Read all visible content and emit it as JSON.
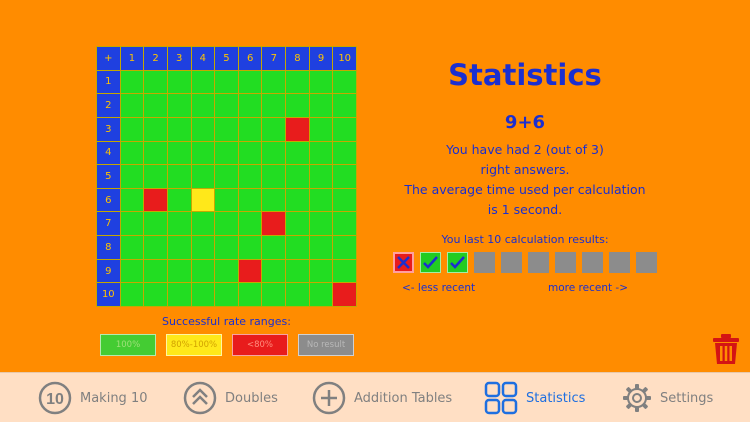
{
  "grid": {
    "corner": "+",
    "columns": [
      "1",
      "2",
      "3",
      "4",
      "5",
      "6",
      "7",
      "8",
      "9",
      "10"
    ],
    "rows": [
      "1",
      "2",
      "3",
      "4",
      "5",
      "6",
      "7",
      "8",
      "9",
      "10"
    ],
    "red_cells": [
      [
        3,
        8
      ],
      [
        6,
        2
      ],
      [
        7,
        7
      ],
      [
        9,
        6
      ],
      [
        10,
        10
      ]
    ],
    "yellow_cells": [
      [
        6,
        4
      ]
    ]
  },
  "legend": {
    "title": "Successful rate ranges:",
    "items": [
      {
        "label": "100%",
        "color": "green"
      },
      {
        "label": "80%-100%",
        "color": "yellow"
      },
      {
        "label": "<80%",
        "color": "red"
      },
      {
        "label": "No result",
        "color": "gray"
      }
    ]
  },
  "stats": {
    "title": "Statistics",
    "calculation": "9+6",
    "line1": "You have had 2 (out of 3)",
    "line2": "right answers.",
    "line3": "The average time used per calculation",
    "line4": "is 1 second.",
    "last_title": "You last 10 calculation results:",
    "results": [
      "wrong",
      "right",
      "right",
      "empty",
      "empty",
      "empty",
      "empty",
      "empty",
      "empty",
      "empty"
    ],
    "less_recent": "<- less recent",
    "more_recent": "more recent ->"
  },
  "tabs": [
    {
      "label": "Making 10",
      "icon": "ten-circle-icon",
      "active": false
    },
    {
      "label": "Doubles",
      "icon": "double-chevron-up-icon",
      "active": false
    },
    {
      "label": "Addition Tables",
      "icon": "plus-circle-icon",
      "active": false
    },
    {
      "label": "Statistics",
      "icon": "grid-squares-icon",
      "active": true
    },
    {
      "label": "Settings",
      "icon": "gear-icon",
      "active": false
    }
  ],
  "icons": {
    "trash": "trash-icon"
  },
  "colors": {
    "background": "#FF8C00",
    "accent_blue": "#1B2FD0",
    "tab_active": "#1E6FE0",
    "cell_green": "#22DD22",
    "cell_red": "#E81C1C",
    "cell_yellow": "#FFE81A"
  }
}
